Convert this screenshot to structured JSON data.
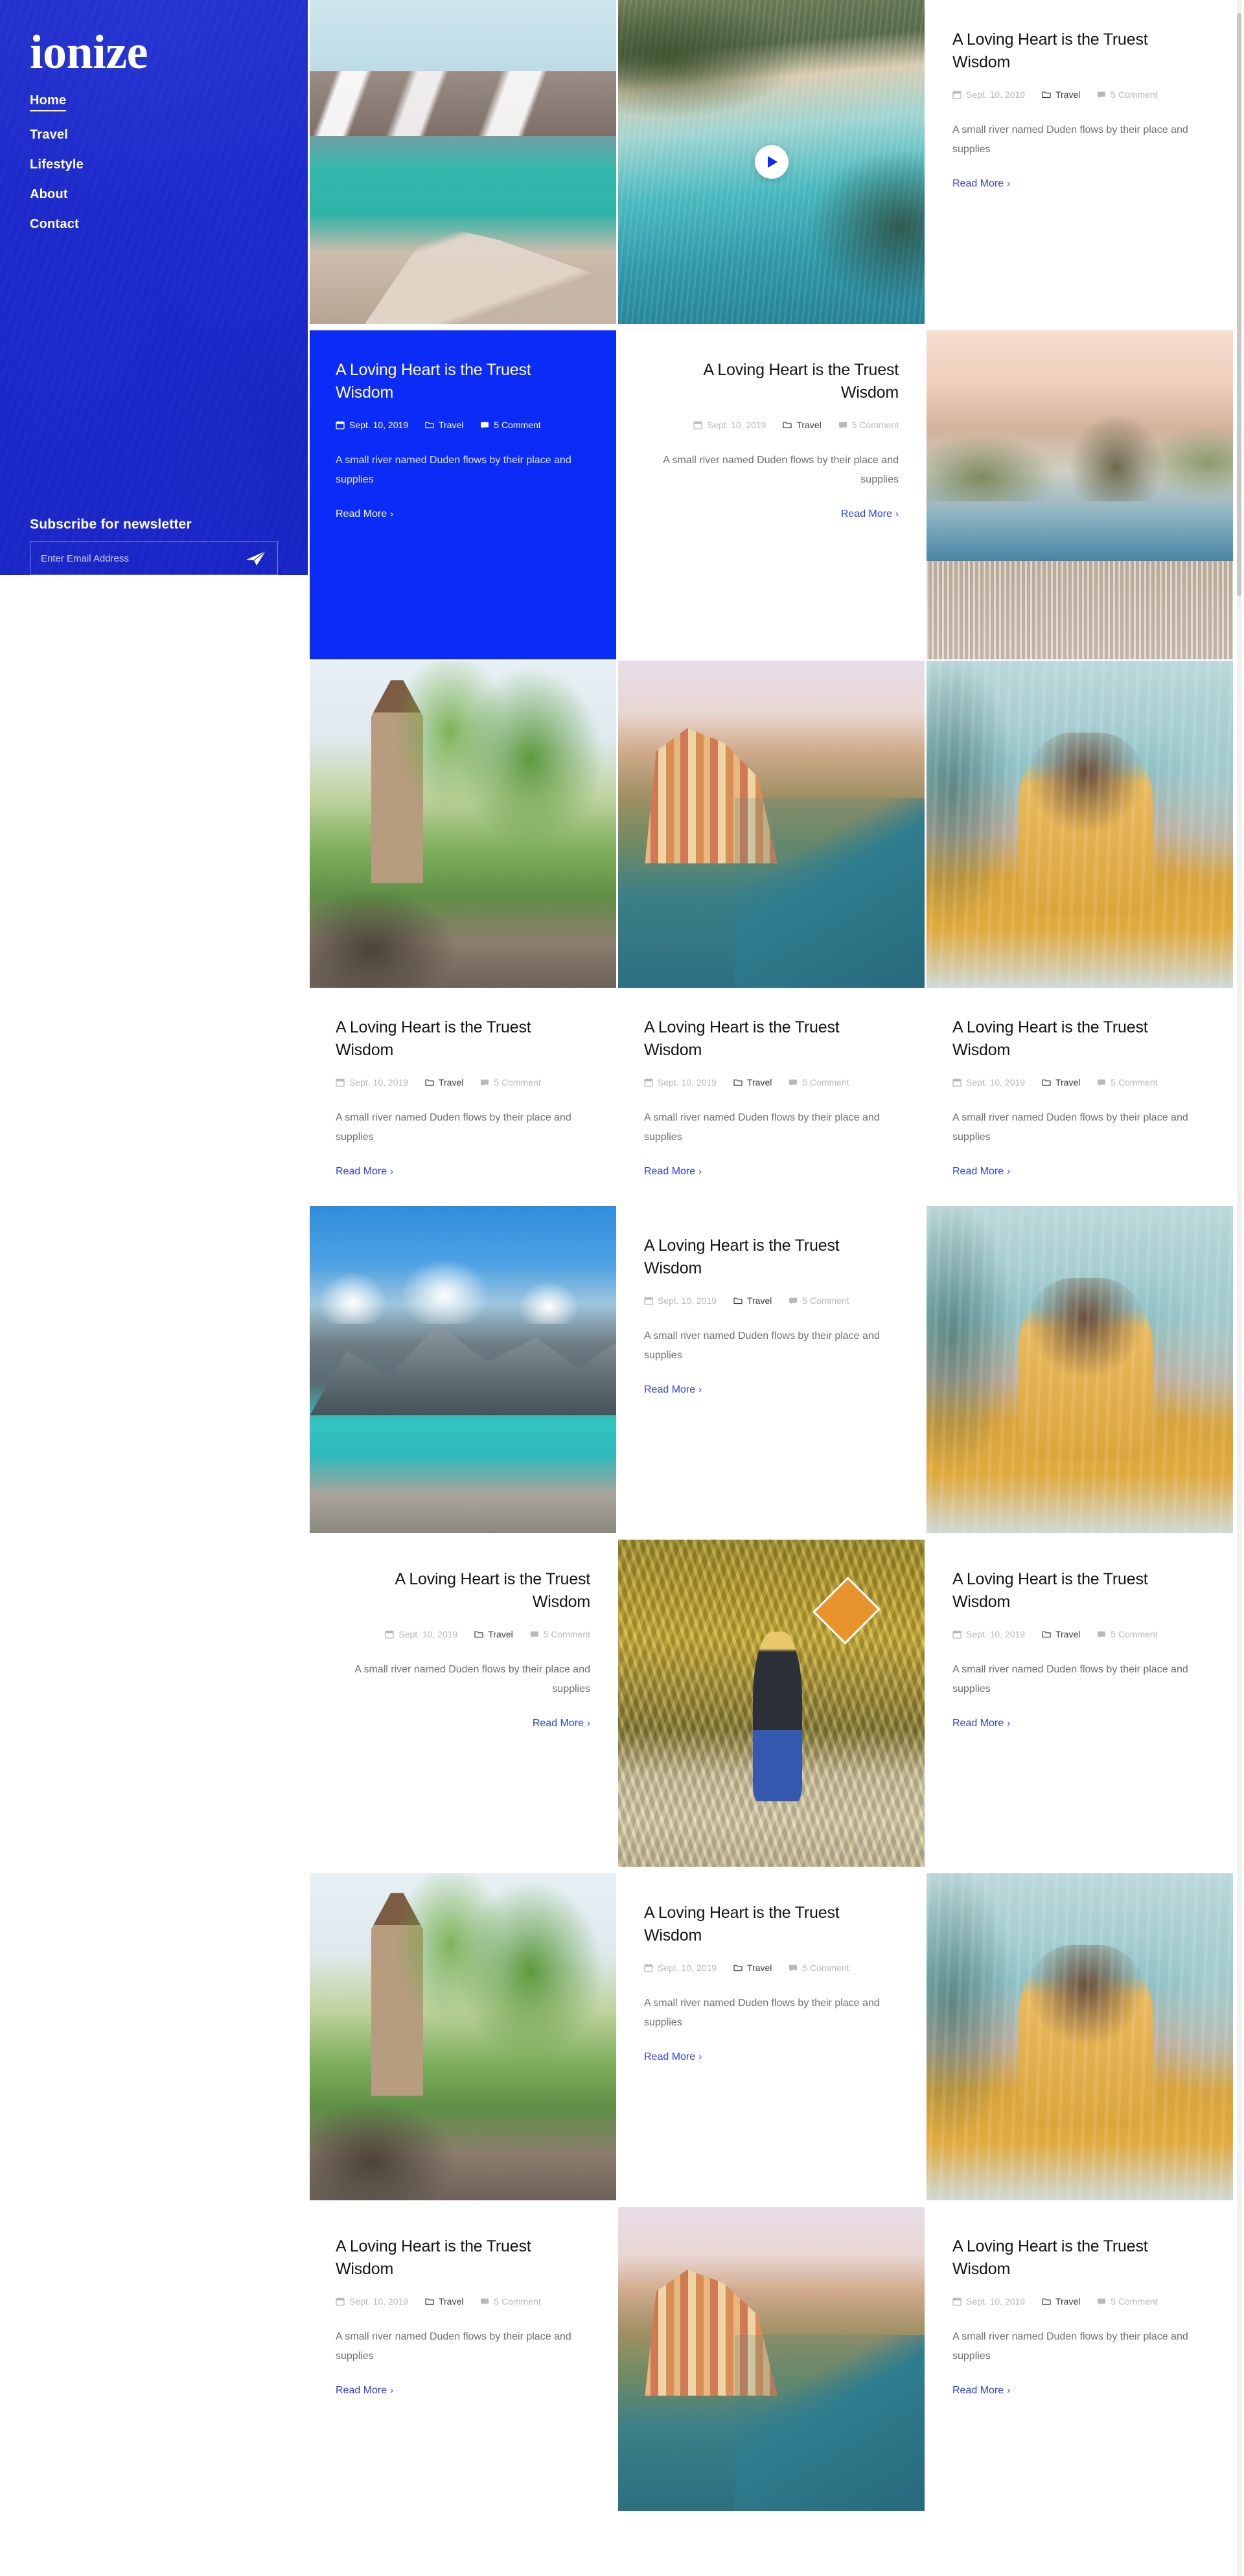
{
  "brand": {
    "logo": "ionize"
  },
  "sidebar": {
    "nav": [
      {
        "label": "Home",
        "active": true
      },
      {
        "label": "Travel",
        "active": false
      },
      {
        "label": "Lifestyle",
        "active": false
      },
      {
        "label": "About",
        "active": false
      },
      {
        "label": "Contact",
        "active": false
      }
    ],
    "newsletter": {
      "title": "Subscribe for newsletter",
      "input_value": "",
      "placeholder": "Enter Email Address",
      "send_icon": "paper-plane-icon"
    }
  },
  "theme": {
    "accent_blue": "#0b2bf7",
    "link_blue": "#2b3fe8",
    "sidebar_blue": "#2c3cd6",
    "text_dark": "#141414",
    "text_muted": "#6f6f74",
    "meta_grey": "#b9b9bd"
  },
  "icons": {
    "calendar": "calendar-icon",
    "folder": "folder-icon",
    "comment": "comment-icon",
    "play": "play-icon",
    "chevron_right": "chevron-right-icon"
  },
  "post": {
    "title": "A Loving Heart is the Truest Wisdom",
    "date": "Sept. 10, 2019",
    "category": "Travel",
    "comments_count": "5",
    "comments_label": "Comment",
    "excerpt": "A small river named Duden flows by their place and supplies",
    "read_more": "Read More"
  },
  "images": {
    "lake": "moraine-lake-photo",
    "coast": "aerial-coast-video-thumbnail",
    "rio": "rio-de-janeiro-photo",
    "clock": "clock-tower-carriage-photo",
    "cinque": "cinque-terre-cliff-village-photo",
    "girl": "woman-yellow-sweater-photo",
    "mountain": "turquoise-mountain-lake-photo",
    "autumn": "autumn-road-hiker-photo",
    "jungle": "jungle-road-photo"
  },
  "grid": {
    "rows": [
      {
        "cells": [
          {
            "kind": "photo",
            "image": "lake"
          },
          {
            "kind": "video",
            "image": "coast"
          },
          {
            "kind": "card",
            "align": "left",
            "variant": "white"
          }
        ]
      },
      {
        "cells": [
          {
            "kind": "card",
            "align": "left",
            "variant": "blue"
          },
          {
            "kind": "card",
            "align": "right",
            "variant": "white"
          },
          {
            "kind": "photo",
            "image": "rio"
          }
        ]
      },
      {
        "cells": [
          {
            "kind": "photo-card",
            "image": "clock",
            "align": "left",
            "variant": "white"
          },
          {
            "kind": "photo-card",
            "image": "cinque",
            "align": "left",
            "variant": "white"
          },
          {
            "kind": "photo-card",
            "image": "girl",
            "align": "left",
            "variant": "white"
          }
        ]
      },
      {
        "cells": [
          {
            "kind": "photo",
            "image": "mountain"
          },
          {
            "kind": "card",
            "align": "left",
            "variant": "white"
          },
          {
            "kind": "photo",
            "image": "girl"
          }
        ]
      },
      {
        "cells": [
          {
            "kind": "card",
            "align": "right",
            "variant": "white"
          },
          {
            "kind": "photo",
            "image": "autumn"
          },
          {
            "kind": "card",
            "align": "left",
            "variant": "white"
          }
        ]
      },
      {
        "cells": [
          {
            "kind": "photo",
            "image": "clock"
          },
          {
            "kind": "card",
            "align": "left",
            "variant": "white"
          },
          {
            "kind": "photo",
            "image": "girl"
          }
        ]
      },
      {
        "cells": [
          {
            "kind": "photo-card",
            "image": "clock",
            "align": "left",
            "variant": "white"
          },
          {
            "kind": "photo",
            "image": "cinque"
          },
          {
            "kind": "photo-card",
            "image": "girl",
            "align": "left",
            "variant": "white"
          }
        ]
      }
    ]
  }
}
